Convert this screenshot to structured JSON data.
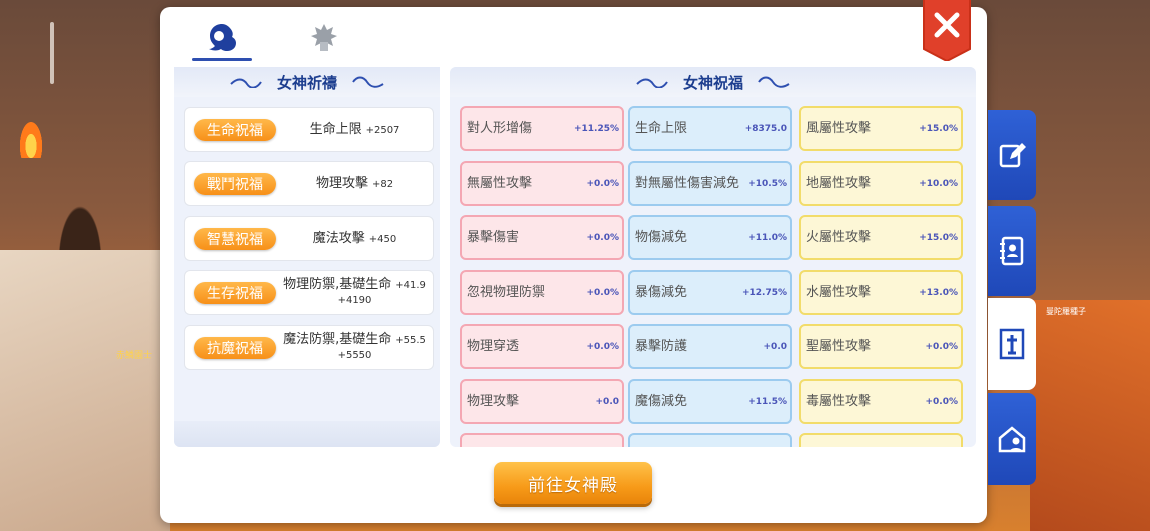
{
  "colors": {
    "accent": "#2e4fb0",
    "orange": "#f79018",
    "close_red": "#e0402a"
  },
  "tabs": [
    {
      "name": "goddess-tab",
      "icon": "goddess-head-icon",
      "active": true
    },
    {
      "name": "emblem-tab",
      "icon": "emblem-icon",
      "active": false
    }
  ],
  "scene": {
    "npc_left": "赤鱗園士",
    "npc_right": "曼陀羅種子"
  },
  "prayer": {
    "title": "女神祈禱",
    "items": [
      {
        "label": "生命祝福",
        "stat": "生命上限",
        "bonus": "+2507",
        "bonus2": ""
      },
      {
        "label": "戰鬥祝福",
        "stat": "物理攻擊",
        "bonus": "+82",
        "bonus2": ""
      },
      {
        "label": "智慧祝福",
        "stat": "魔法攻擊",
        "bonus": "+450",
        "bonus2": ""
      },
      {
        "label": "生存祝福",
        "stat": "物理防禦,基礎生命",
        "bonus": "+41.9",
        "bonus2": "+4190"
      },
      {
        "label": "抗魔祝福",
        "stat": "魔法防禦,基礎生命",
        "bonus": "+55.5",
        "bonus2": "+5550"
      }
    ]
  },
  "blessing": {
    "title": "女神祝福",
    "columns": [
      {
        "color": "pink",
        "items": [
          {
            "name": "對人形增傷",
            "value": "+11.25%"
          },
          {
            "name": "無屬性攻擊",
            "value": "+0.0%"
          },
          {
            "name": "暴擊傷害",
            "value": "+0.0%"
          },
          {
            "name": "忽視物理防禦",
            "value": "+0.0%"
          },
          {
            "name": "物理穿透",
            "value": "+0.0%"
          },
          {
            "name": "物理攻擊",
            "value": "+0.0"
          }
        ]
      },
      {
        "color": "blue",
        "items": [
          {
            "name": "生命上限",
            "value": "+8375.0"
          },
          {
            "name": "對無屬性傷害減免",
            "value": "+10.5%"
          },
          {
            "name": "物傷減免",
            "value": "+11.0%"
          },
          {
            "name": "暴傷減免",
            "value": "+12.75%"
          },
          {
            "name": "暴擊防護",
            "value": "+0.0"
          },
          {
            "name": "魔傷減免",
            "value": "+11.5%"
          }
        ]
      },
      {
        "color": "yellow",
        "items": [
          {
            "name": "風屬性攻擊",
            "value": "+15.0%"
          },
          {
            "name": "地屬性攻擊",
            "value": "+10.0%"
          },
          {
            "name": "火屬性攻擊",
            "value": "+15.0%"
          },
          {
            "name": "水屬性攻擊",
            "value": "+13.0%"
          },
          {
            "name": "聖屬性攻擊",
            "value": "+0.0%"
          },
          {
            "name": "毒屬性攻擊",
            "value": "+0.0%"
          }
        ]
      }
    ]
  },
  "side_tabs": [
    {
      "icon": "edit-icon",
      "active": false
    },
    {
      "icon": "contact-book-icon",
      "active": false
    },
    {
      "icon": "goddess-shrine-icon",
      "active": true
    },
    {
      "icon": "home-user-icon",
      "active": false
    }
  ],
  "go_button": "前往女神殿"
}
